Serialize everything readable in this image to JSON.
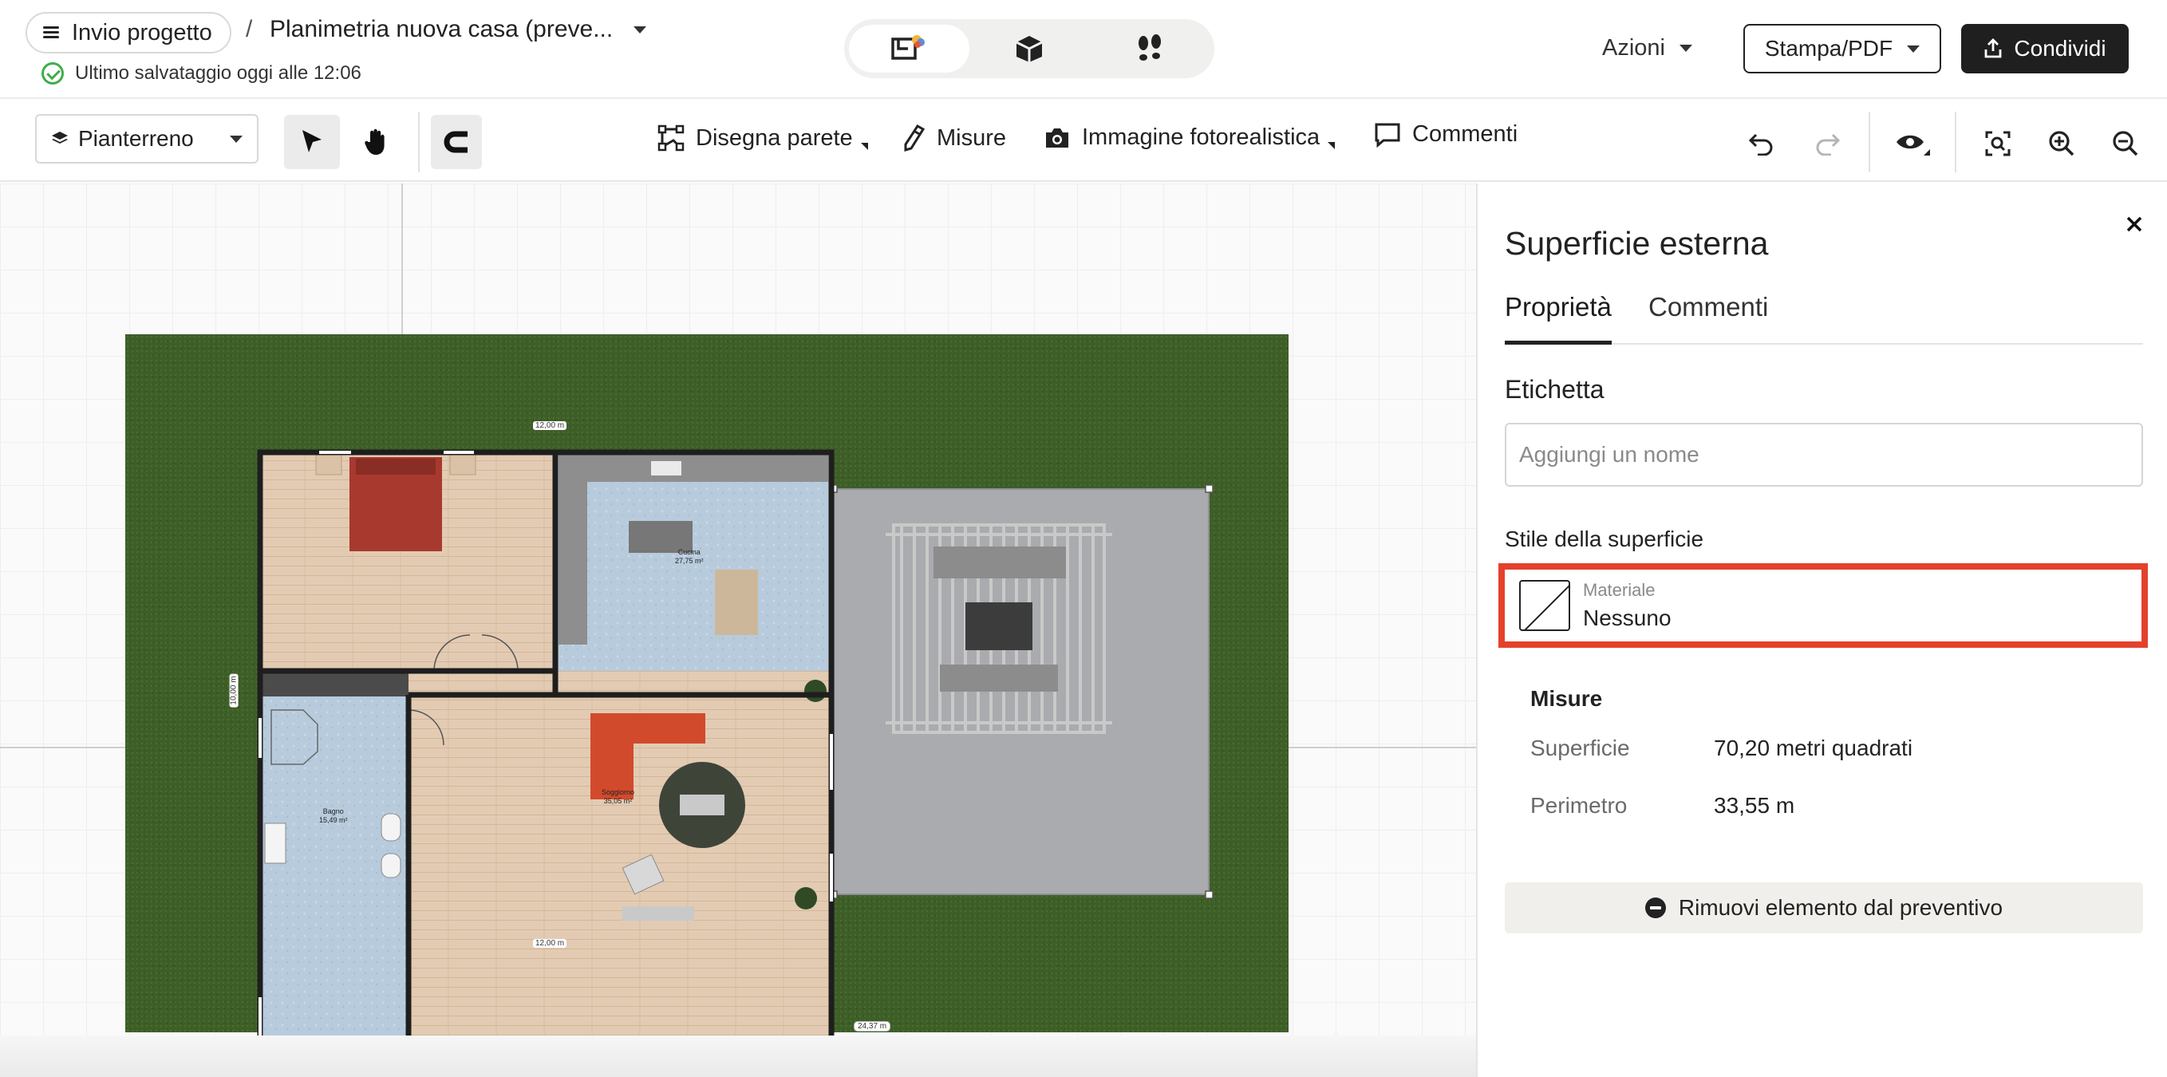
{
  "header": {
    "project_button_label": "Invio progetto",
    "separator": "/",
    "project_title": "Planimetria nuova casa (preve...",
    "saved_status": "Ultimo salvataggio oggi alle 12:06",
    "view_modes": [
      "2d-plan-icon",
      "3d-box-icon",
      "walkthrough-footprints-icon"
    ],
    "actions_label": "Azioni",
    "print_label": "Stampa/PDF",
    "share_label": "Condividi"
  },
  "toolbar": {
    "floor_label": "Pianterreno",
    "draw_wall_label": "Disegna parete",
    "measures_label": "Misure",
    "render_label": "Immagine fotorealistica",
    "comments_label": "Commenti"
  },
  "plan": {
    "dim_top": "12,00 m",
    "dim_bottom": "12,00 m",
    "dim_left": "10,00 m",
    "dim_site": "24,37 m",
    "rooms": [
      {
        "name": "Cucina",
        "area": "27,75 m²"
      },
      {
        "name": "Bagno",
        "area": "15,49 m²"
      },
      {
        "name": "Soggiorno",
        "area": "35,05 m²"
      }
    ],
    "colors": {
      "grass": "#3e5e28",
      "wall": "#1e1e1e",
      "terrace": "#a9abae",
      "wood_floor": "#e3cbb3",
      "tile_floor": "#b7cbdc",
      "sofa": "#d24a2c",
      "bed": "#a8392e"
    }
  },
  "panel": {
    "title": "Superficie esterna",
    "tabs": [
      "Proprietà",
      "Commenti"
    ],
    "label_section": "Etichetta",
    "name_placeholder": "Aggiungi un nome",
    "style_section": "Stile della superficie",
    "material_label": "Materiale",
    "material_value": "Nessuno",
    "measures_title": "Misure",
    "area_key": "Superficie",
    "area_value": "70,20 metri quadrati",
    "perimeter_key": "Perimetro",
    "perimeter_value": "33,55 m",
    "remove_label": "Rimuovi elemento dal preventivo",
    "highlight_color": "#e4412c"
  }
}
